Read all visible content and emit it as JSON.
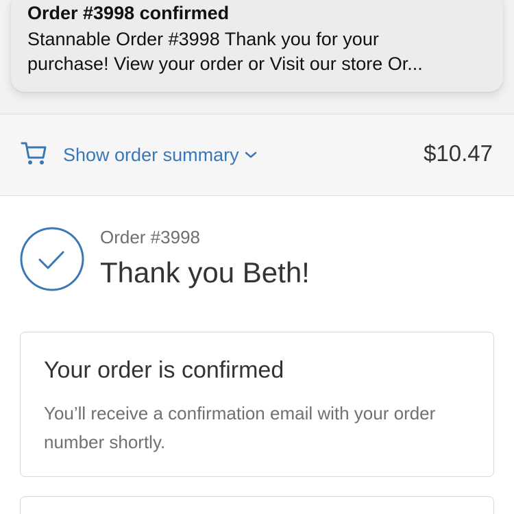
{
  "notification": {
    "title": "Order #3998 confirmed",
    "body_line1": "Stannable Order #3998 Thank you for your",
    "body_line2": "purchase! View your order or Visit our store Or..."
  },
  "summary": {
    "toggle_label": "Show order summary",
    "total": "$10.47",
    "cart_icon": "cart-icon",
    "chevron_icon": "chevron-down-icon",
    "accent_color": "#3a78b5"
  },
  "order": {
    "number": "Order #3998",
    "thank_you": "Thank you Beth!",
    "status_icon": "checkmark-circle-icon"
  },
  "confirmation": {
    "heading": "Your order is confirmed",
    "message": "You’ll receive a confirmation email with your order number shortly."
  }
}
